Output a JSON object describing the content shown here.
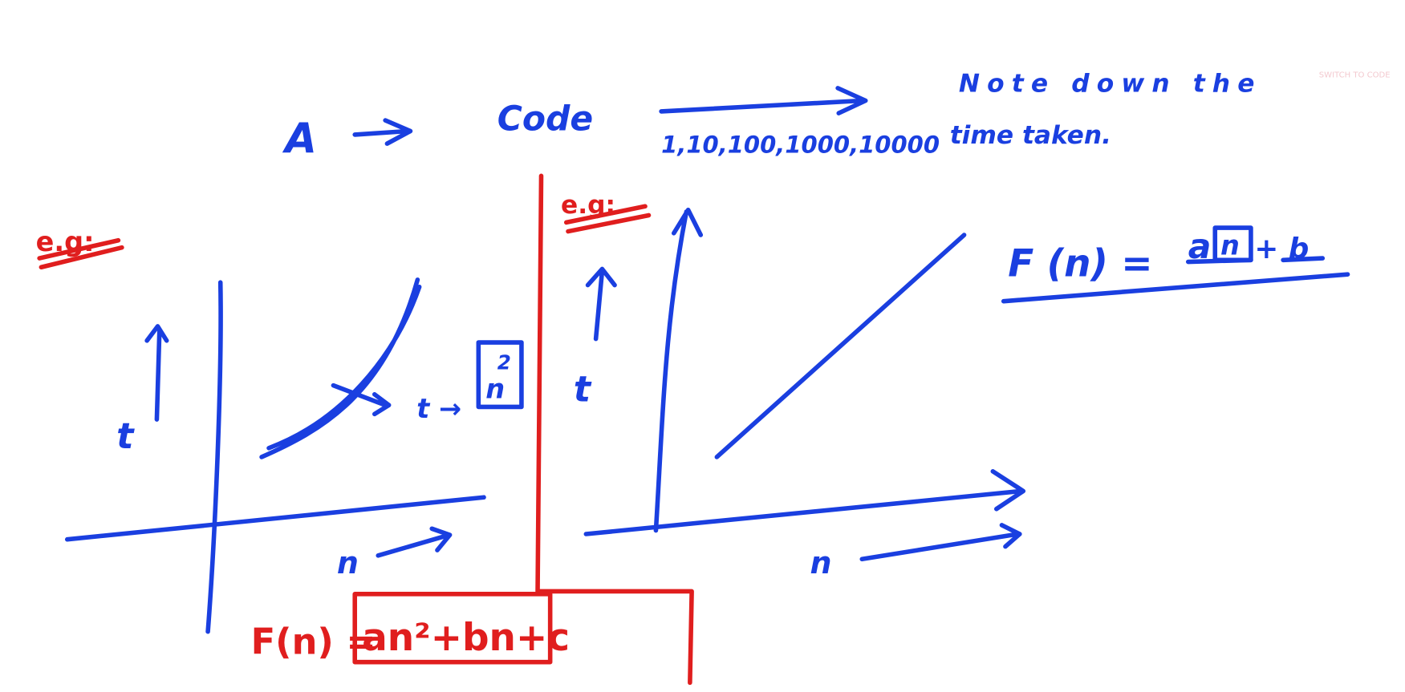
{
  "top": {
    "a_label": "A",
    "code_label": "Code",
    "inputs": "1,10,100,1000,10000",
    "note_line1": "Note down the",
    "note_line2": "time taken."
  },
  "watermark": "SWITCH TO CODE",
  "left_graph": {
    "eg": "e.g:",
    "y_label": "t",
    "x_label": "n",
    "t_arrow": "t →",
    "box_power": "2",
    "box_base": "n",
    "formula_prefix": "F(n) =",
    "formula_box": "an²+bn+c"
  },
  "right_graph": {
    "eg": "e.g:",
    "y_label": "t",
    "x_label": "n",
    "formula_prefix": "F (n) =",
    "formula_a": "a",
    "formula_n": "n",
    "formula_rest": "+ b"
  },
  "colors": {
    "ink_blue": "#1a3fe0",
    "ink_red": "#e01e1e"
  }
}
